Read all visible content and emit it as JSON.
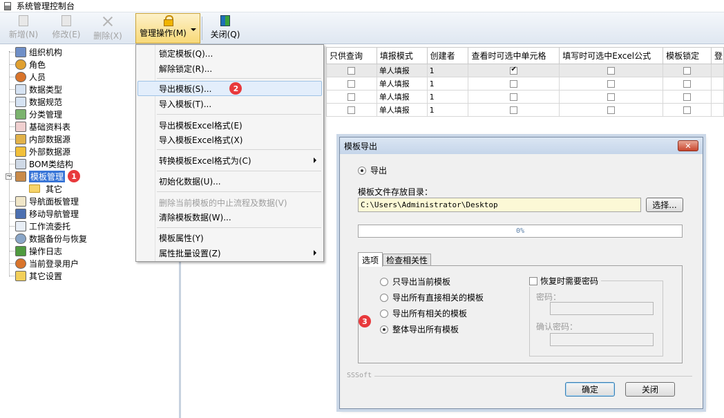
{
  "window": {
    "title": "系统管理控制台"
  },
  "toolbar": {
    "new_label": "新增(N)",
    "edit_label": "修改(E)",
    "delete_label": "删除(X)",
    "manage_label": "管理操作(M)",
    "close_label": "关闭(Q)"
  },
  "tree": {
    "items": [
      {
        "label": "组织机构",
        "icon": "org-icon"
      },
      {
        "label": "角色",
        "icon": "role-icon"
      },
      {
        "label": "人员",
        "icon": "user-icon"
      },
      {
        "label": "数据类型",
        "icon": "datatype-icon"
      },
      {
        "label": "数据规范",
        "icon": "dataspec-icon"
      },
      {
        "label": "分类管理",
        "icon": "category-icon"
      },
      {
        "label": "基础资料表",
        "icon": "basetable-icon"
      },
      {
        "label": "内部数据源",
        "icon": "internal-source-icon"
      },
      {
        "label": "外部数据源",
        "icon": "external-source-icon"
      },
      {
        "label": "BOM类结构",
        "icon": "bom-icon"
      },
      {
        "label": "模板管理",
        "icon": "template-icon"
      },
      {
        "label": "其它",
        "icon": "folder-icon"
      },
      {
        "label": "导航面板管理",
        "icon": "nav-panel-icon"
      },
      {
        "label": "移动导航管理",
        "icon": "mobile-nav-icon"
      },
      {
        "label": "工作流委托",
        "icon": "workflow-icon"
      },
      {
        "label": "数据备份与恢复",
        "icon": "backup-icon"
      },
      {
        "label": "操作日志",
        "icon": "log-icon"
      },
      {
        "label": "当前登录用户",
        "icon": "current-user-icon"
      },
      {
        "label": "其它设置",
        "icon": "settings-icon"
      }
    ],
    "badge_1": "1"
  },
  "grid": {
    "headers": [
      "只供查询",
      "填报模式",
      "创建者",
      "查看时可选中单元格",
      "填写时可选中Excel公式",
      "模板锁定",
      "登"
    ],
    "rows": [
      {
        "mode": "单人填报",
        "creator": "1",
        "view_select": true
      },
      {
        "mode": "单人填报",
        "creator": "1",
        "view_select": false
      },
      {
        "mode": "单人填报",
        "creator": "1",
        "view_select": false
      },
      {
        "mode": "单人填报",
        "creator": "1",
        "view_select": false
      }
    ]
  },
  "menu": {
    "items": [
      "锁定模板(Q)...",
      "解除锁定(R)...",
      "导出模板(S)...",
      "导入模板(T)...",
      "导出模板Excel格式(E)",
      "导入模板Excel格式(X)",
      "转换模板Excel格式为(C)",
      "初始化数据(U)...",
      "删除当前模板的中止流程及数据(V)",
      "清除模板数据(W)...",
      "模板属性(Y)",
      "属性批量设置(Z)"
    ],
    "badge_2": "2"
  },
  "dialog": {
    "title": "模板导出",
    "close_glyph": "✕",
    "export_radio": "导出",
    "dir_label": "模板文件存放目录：",
    "dir_value": "C:\\Users\\Administrator\\Desktop",
    "choose_button": "选择...",
    "progress_text": "0%",
    "tab_options": "选项",
    "tab_check": "检查相关性",
    "options": [
      "只导出当前模板",
      "导出所有直接相关的模板",
      "导出所有相关的模板",
      "整体导出所有模板"
    ],
    "selected_option": 3,
    "password_check": "恢复时需要密码",
    "password_label": "密码：",
    "confirm_password_label": "确认密码：",
    "footer_brand": "SSSoft",
    "ok_button": "确定",
    "close_button": "关闭",
    "badge_3": "3"
  },
  "colors": {
    "selection": "#3875d7",
    "badge": "#e8393c",
    "manage_button": "#f8d978"
  }
}
